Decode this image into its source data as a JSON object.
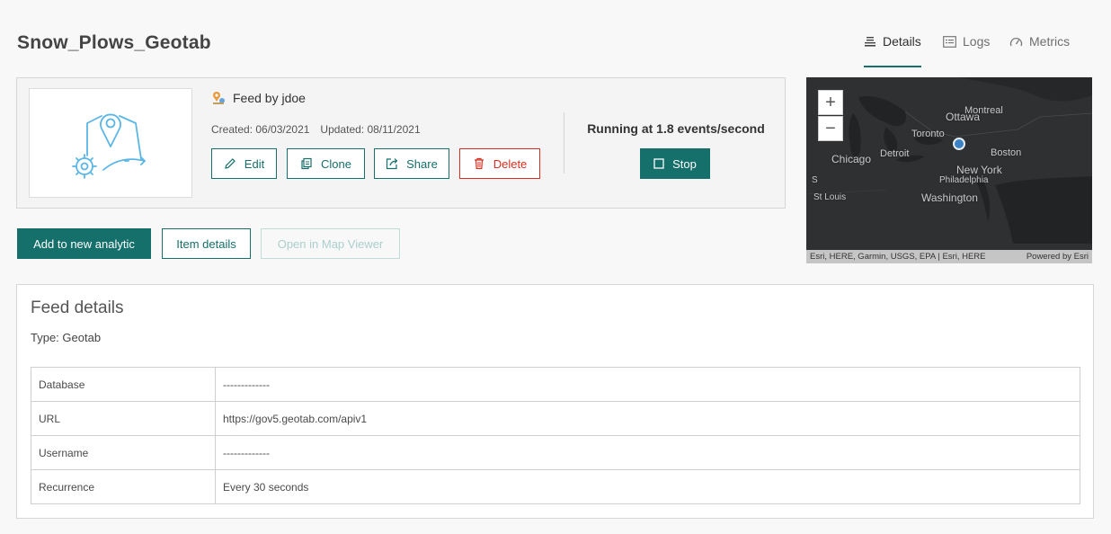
{
  "page": {
    "title": "Snow_Plows_Geotab"
  },
  "tabs": [
    {
      "label": "Details",
      "icon": "details-icon",
      "active": true
    },
    {
      "label": "Logs",
      "icon": "logs-icon",
      "active": false
    },
    {
      "label": "Metrics",
      "icon": "metrics-icon",
      "active": false
    }
  ],
  "feed": {
    "owner": "Feed by jdoe",
    "created": "Created: 06/03/2021",
    "updated": "Updated: 08/11/2021",
    "status": "Running at 1.8 events/second",
    "buttons": {
      "edit": "Edit",
      "clone": "Clone",
      "share": "Share",
      "delete": "Delete",
      "stop": "Stop"
    }
  },
  "actions": {
    "add_analytic": "Add to new analytic",
    "item_details": "Item details",
    "open_map": "Open in Map Viewer"
  },
  "map": {
    "zoom_in": "+",
    "zoom_out": "−",
    "labels": {
      "ottawa": "Ottawa",
      "montreal": "Montreal",
      "toronto": "Toronto",
      "chicago": "Chicago",
      "detroit": "Detroit",
      "boston": "Boston",
      "new_york": "New York",
      "philadelphia": "Philadelphia",
      "washington": "Washington",
      "st_louis": "St Louis",
      "edge_s": "S"
    },
    "attribution": "Esri, HERE, Garmin, USGS, EPA | Esri, HERE",
    "powered_by": "Powered by Esri"
  },
  "details": {
    "title": "Feed details",
    "type": "Type: Geotab",
    "rows": [
      {
        "key": "Database",
        "value": "-------------"
      },
      {
        "key": "URL",
        "value": "https://gov5.geotab.com/apiv1"
      },
      {
        "key": "Username",
        "value": "-------------"
      },
      {
        "key": "Recurrence",
        "value": "Every 30 seconds"
      }
    ]
  },
  "colors": {
    "accent": "#156f6b",
    "danger": "#d83020",
    "map_background": "#2f3032",
    "map_point": "#3b82c4"
  }
}
